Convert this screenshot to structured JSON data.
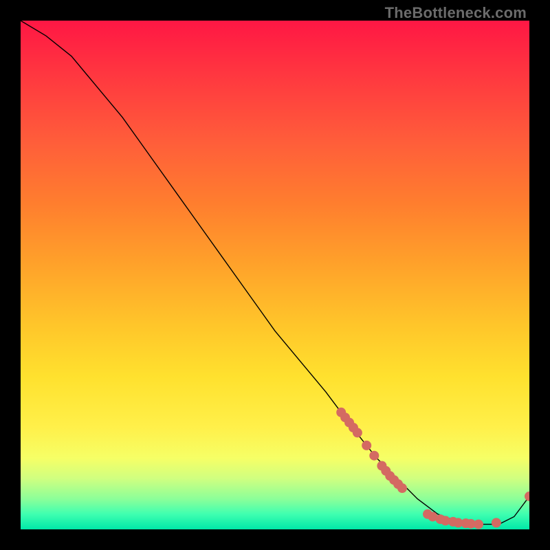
{
  "watermark": "TheBottleneck.com",
  "chart_data": {
    "type": "line",
    "title": "",
    "xlabel": "",
    "ylabel": "",
    "xlim": [
      0,
      100
    ],
    "ylim": [
      0,
      100
    ],
    "grid": false,
    "legend": false,
    "background": "rainbow-vertical-gradient",
    "series": [
      {
        "name": "bottleneck-curve",
        "color": "#000000",
        "x": [
          0,
          5,
          10,
          15,
          20,
          25,
          30,
          35,
          40,
          45,
          50,
          55,
          60,
          63,
          66,
          70,
          74,
          78,
          82,
          86,
          90,
          94,
          97,
          100
        ],
        "y": [
          100,
          97,
          93,
          87,
          81,
          74,
          67,
          60,
          53,
          46,
          39,
          33,
          27,
          23,
          19,
          14,
          10,
          6,
          3,
          1.5,
          1,
          1,
          2.5,
          6.5
        ]
      }
    ],
    "markers": {
      "name": "highlight-dots",
      "color": "#d46a62",
      "radius": 7,
      "points": [
        {
          "x": 63.0,
          "y": 23.0
        },
        {
          "x": 63.8,
          "y": 22.0
        },
        {
          "x": 64.6,
          "y": 21.0
        },
        {
          "x": 65.4,
          "y": 20.0
        },
        {
          "x": 66.2,
          "y": 19.0
        },
        {
          "x": 68.0,
          "y": 16.5
        },
        {
          "x": 69.5,
          "y": 14.5
        },
        {
          "x": 71.0,
          "y": 12.5
        },
        {
          "x": 71.8,
          "y": 11.5
        },
        {
          "x": 72.6,
          "y": 10.5
        },
        {
          "x": 73.4,
          "y": 9.7
        },
        {
          "x": 74.2,
          "y": 8.9
        },
        {
          "x": 75.0,
          "y": 8.1
        },
        {
          "x": 80.0,
          "y": 3.0
        },
        {
          "x": 81.0,
          "y": 2.5
        },
        {
          "x": 82.5,
          "y": 2.0
        },
        {
          "x": 83.5,
          "y": 1.7
        },
        {
          "x": 85.0,
          "y": 1.5
        },
        {
          "x": 86.0,
          "y": 1.3
        },
        {
          "x": 87.5,
          "y": 1.2
        },
        {
          "x": 88.5,
          "y": 1.1
        },
        {
          "x": 90.0,
          "y": 1.0
        },
        {
          "x": 93.5,
          "y": 1.3
        },
        {
          "x": 100.0,
          "y": 6.5
        }
      ]
    }
  }
}
